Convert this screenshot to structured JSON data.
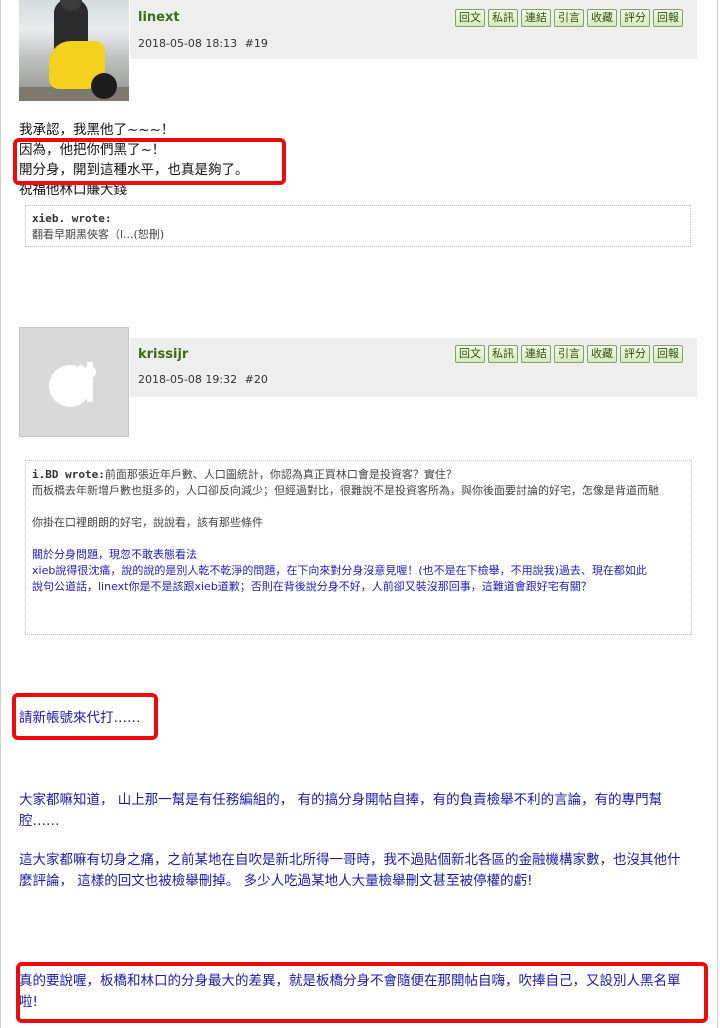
{
  "actions": [
    "回文",
    "私訊",
    "連結",
    "引言",
    "收藏",
    "評分",
    "回報"
  ],
  "post19": {
    "username": "linext",
    "date": "2018-05-08 18:13",
    "floor": "#19",
    "lines": [
      "我承認，我黑他了~~~！",
      "因為，他把你們黑了~！",
      "開分身，開到這種水平，也真是夠了。",
      "祝福他林口賺大錢"
    ],
    "quote": {
      "author": "xieb. wrote:",
      "text": "翻看早期黑俠客（l...(恕刪)"
    }
  },
  "post20": {
    "username": "krissijr",
    "date": "2018-05-08 19:32",
    "floor": "#20",
    "quote": {
      "author": "i.BD wrote:",
      "line1": "前面那張近年戶數、人口圖統計，你認為真正買林口會是投資客？實住？",
      "line2": "而板橋去年新增戶數也挺多的，人口卻反向減少；但經過對比，很難說不是投資客所為，與你後面要討論的好宅，怎像是背道而馳",
      "line3": "你掛在口裡朗朗的好宅，說說看，該有那些條件",
      "blue1": "關於分身問題，現忽不敢表態看法",
      "blue2": "xieb說得很沈痛，說的說的是別人乾不乾淨的問題，在下向來對分身沒意見喔！(也不是在下檢舉，不用說我)過去、現在都如此",
      "blue3": "說句公道話，linext你是不是該跟xieb道歉；否則在背後說分身不好，人前卻又裝沒那回事，這難道會跟好宅有關？"
    },
    "reply": "請新帳號來代打……",
    "para1": "大家都嘛知道， 山上那一幫是有任務編組的， 有的搞分身開帖自捧，有的負責檢舉不利的言論，有的專門幫腔……",
    "para2": "這大家都嘛有切身之痛，之前某地在自吹是新北所得一哥時，我不過貼個新北各區的金融機構家數，也沒其他什麼評論， 這樣的回文也被檢舉刪掉。 多少人吃過某地人大量檢舉刪文甚至被停權的虧!",
    "para3": "真的要說喔，板橋和林口的分身最大的差異，就是板橋分身不會隨便在那開帖自嗨，吹捧自己，又設別人黑名單啦!"
  },
  "colors": {
    "highlight_red": "#ee0a0a",
    "username_green": "#3b6e12",
    "reply_blue": "#1a1aa6"
  }
}
